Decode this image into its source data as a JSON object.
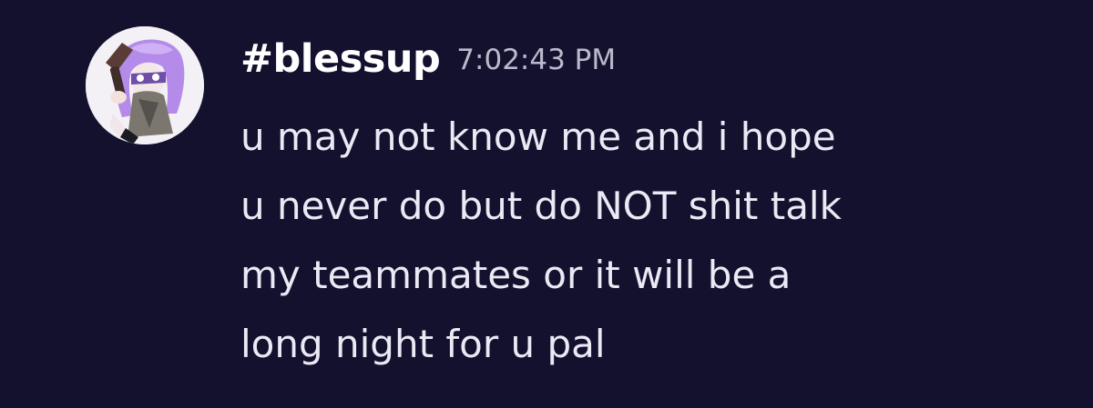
{
  "message": {
    "avatar_icon": "inkling-character-avatar",
    "username": "#blessup",
    "timestamp": "7:02:43 PM",
    "lines": [
      "u may not know me and i hope",
      "u never do but do NOT shit talk",
      "my teammates or it will be a",
      "long night for u pal"
    ]
  },
  "colors": {
    "background": "#13112e",
    "username": "#ffffff",
    "timestamp": "#bdb9cc",
    "text": "#ebe9f4",
    "avatar_hair": "#b48be8"
  }
}
